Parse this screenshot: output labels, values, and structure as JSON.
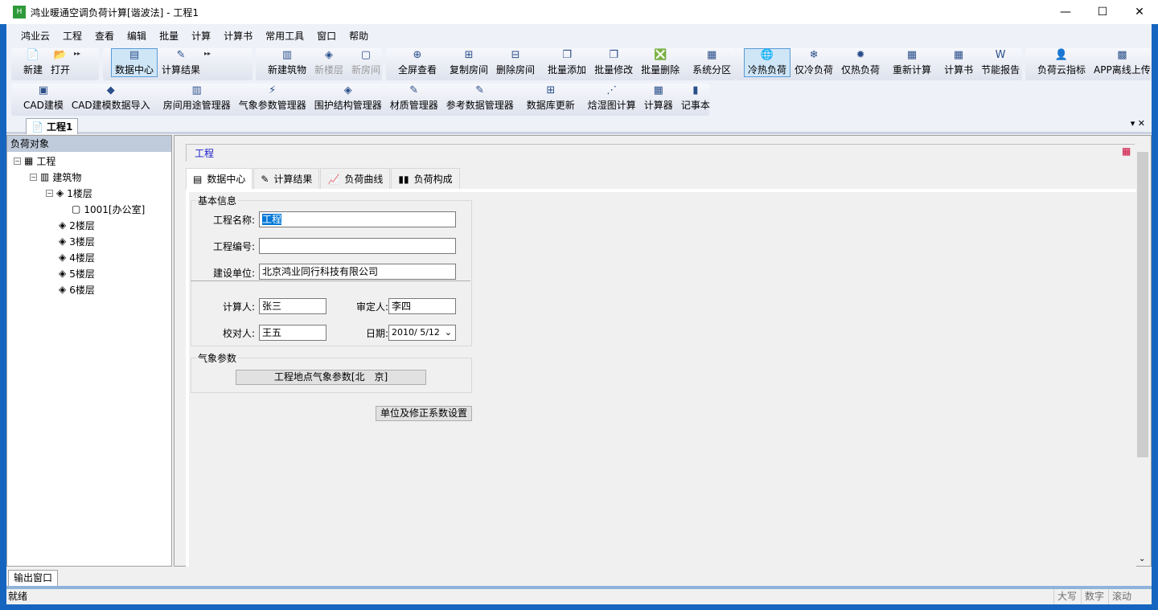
{
  "window": {
    "title": "鸿业暖通空调负荷计算[谐波法] - 工程1",
    "minimize": "—",
    "maximize": "☐",
    "close": "✕"
  },
  "menu": [
    "鸿业云",
    "工程",
    "查看",
    "编辑",
    "批量",
    "计算",
    "计算书",
    "常用工具",
    "窗口",
    "帮助"
  ],
  "toolbar1": {
    "g1": [
      {
        "label": "新建",
        "icon": "📄"
      },
      {
        "label": "打开",
        "icon": "📂"
      }
    ],
    "g2": [
      {
        "label": "数据中心",
        "icon": "▤"
      },
      {
        "label": "计算结果",
        "icon": "✎"
      }
    ],
    "g3": [
      {
        "label": "新建筑物",
        "icon": "▥"
      },
      {
        "label": "新楼层",
        "icon": "◈"
      },
      {
        "label": "新房间",
        "icon": "▢"
      }
    ],
    "g4": [
      {
        "label": "全屏查看",
        "icon": "⊕"
      },
      {
        "label": "复制房间",
        "icon": "⊞"
      },
      {
        "label": "删除房间",
        "icon": "⊟"
      },
      {
        "label": "批量添加",
        "icon": "❐"
      },
      {
        "label": "批量修改",
        "icon": "❐"
      },
      {
        "label": "批量删除",
        "icon": "❎"
      },
      {
        "label": "系统分区",
        "icon": "▦"
      }
    ],
    "g5": [
      {
        "label": "冷热负荷",
        "icon": "🌐"
      },
      {
        "label": "仅冷负荷",
        "icon": "❄"
      },
      {
        "label": "仅热负荷",
        "icon": "✹"
      },
      {
        "label": "重新计算",
        "icon": "▦"
      },
      {
        "label": "计算书",
        "icon": "▦"
      },
      {
        "label": "节能报告",
        "icon": "W"
      }
    ],
    "g6": [
      {
        "label": "负荷云指标",
        "icon": "👤"
      },
      {
        "label": "APP离线上传",
        "icon": "▩"
      }
    ]
  },
  "toolbar2": [
    {
      "label": "CAD建模",
      "icon": "▣"
    },
    {
      "label": "CAD建模数据导入",
      "icon": "◆"
    },
    {
      "label": "房间用途管理器",
      "icon": "▥"
    },
    {
      "label": "气象参数管理器",
      "icon": "⚡"
    },
    {
      "label": "围护结构管理器",
      "icon": "◈"
    },
    {
      "label": "材质管理器",
      "icon": "✎"
    },
    {
      "label": "参考数据管理器",
      "icon": "✎"
    },
    {
      "label": "数据库更新",
      "icon": "⊞"
    },
    {
      "label": "焓湿图计算",
      "icon": "⋰"
    },
    {
      "label": "计算器",
      "icon": "▦"
    },
    {
      "label": "记事本",
      "icon": "▮"
    }
  ],
  "doc_tab": "工程1",
  "tree": {
    "header": "负荷对象",
    "nodes": [
      "工程",
      "建筑物",
      "1楼层",
      "1001[办公室]",
      "2楼层",
      "3楼层",
      "4楼层",
      "5楼层",
      "6楼层"
    ]
  },
  "content": {
    "header": "工程",
    "tabs": [
      "数据中心",
      "计算结果",
      "负荷曲线",
      "负荷构成"
    ],
    "basic": {
      "legend": "基本信息",
      "name_label": "工程名称:",
      "name_value": "工程",
      "code_label": "工程编号:",
      "code_value": "",
      "unit_label": "建设单位:",
      "unit_value": "北京鸿业同行科技有限公司",
      "calc_label": "计算人:",
      "calc_value": "张三",
      "approve_label": "审定人:",
      "approve_value": "李四",
      "check_label": "校对人:",
      "check_value": "王五",
      "date_label": "日期:",
      "date_value": "2010/ 5/12"
    },
    "weather": {
      "legend": "气象参数",
      "button": "工程地点气象参数[北　京]"
    },
    "unit_button": "单位及修正系数设置"
  },
  "output_tab": "输出窗口",
  "status": {
    "text": "就绪",
    "caps": "大写",
    "num": "数字",
    "scroll": "滚动"
  }
}
